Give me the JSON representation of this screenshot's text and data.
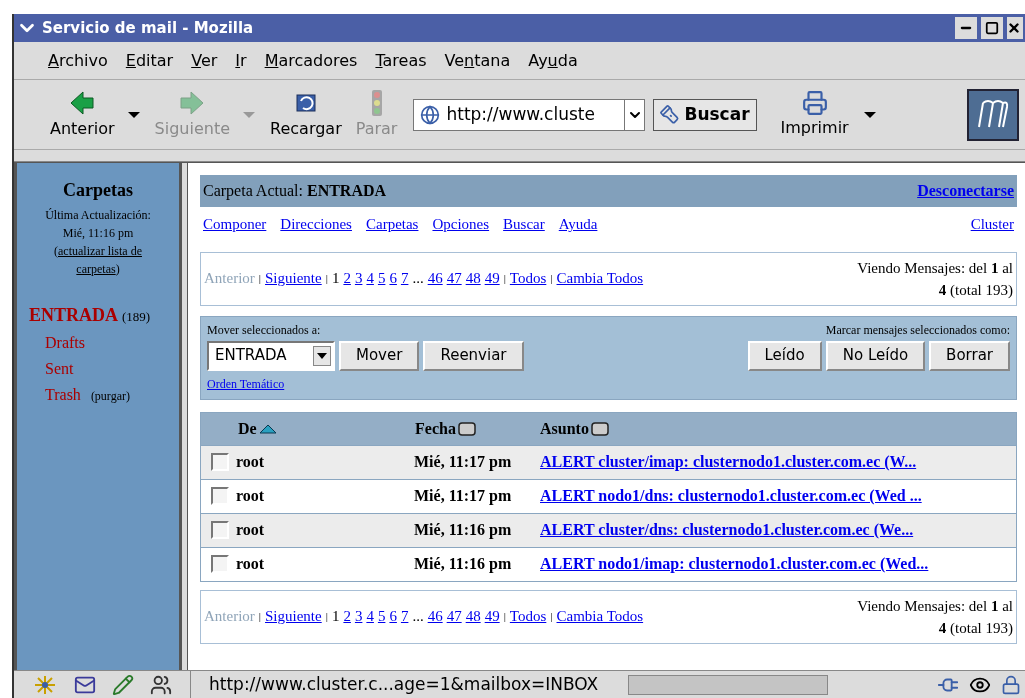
{
  "window": {
    "title": "Servicio de mail - Mozilla"
  },
  "menu": [
    {
      "key": "A",
      "after": "rchivo"
    },
    {
      "key": "E",
      "after": "ditar"
    },
    {
      "key": "V",
      "after": "er"
    },
    {
      "key": "I",
      "after": "r"
    },
    {
      "key": "M",
      "after": "arcadores"
    },
    {
      "key": "T",
      "after": "areas"
    },
    {
      "before": "Ve",
      "key": "n",
      "after": "tana"
    },
    {
      "before": "Ay",
      "key": "u",
      "after": "da"
    }
  ],
  "toolbar": [
    {
      "kind": "back",
      "label": "Anterior",
      "disabled": false,
      "dropdown": true
    },
    {
      "kind": "forward",
      "label": "Siguiente",
      "disabled": true,
      "dropdown": true
    },
    {
      "kind": "reload",
      "label": "Recargar",
      "disabled": false,
      "dropdown": false
    },
    {
      "kind": "stop",
      "label": "Parar",
      "disabled": true,
      "dropdown": false
    }
  ],
  "address": {
    "value": "http://www.cluste"
  },
  "search_button": "Buscar",
  "print": {
    "label": "Imprimir",
    "dropdown": true
  },
  "sidebar": {
    "title": "Carpetas",
    "updated_label": "Última Actualización:",
    "updated_time": "Mié, 11:16 pm",
    "refresh_open": "(",
    "refresh_link": "actualizar lista de carpetas",
    "refresh_close": ")",
    "folders": [
      {
        "name": "ENTRADA",
        "count": "(189)",
        "selected": true
      },
      {
        "name": "Drafts",
        "selected": false
      },
      {
        "name": "Sent",
        "selected": false
      },
      {
        "name": "Trash",
        "extra": "(purgar)",
        "selected": false
      }
    ]
  },
  "header": {
    "text": "Carpeta Actual: **ENTRADA**",
    "logout": "Desconectarse"
  },
  "nav_links": [
    "Componer",
    "Direcciones",
    "Carpetas",
    "Opciones",
    "Buscar",
    "Ayuda"
  ],
  "nav_right": "Cluster",
  "pagination_top": {
    "items": [
      {
        "kind": "disabled",
        "text": "Anterior"
      },
      {
        "kind": "separator",
        "text": "|"
      },
      {
        "kind": "link",
        "text": "Siguiente"
      },
      {
        "kind": "separator",
        "text": "|"
      },
      {
        "kind": "current",
        "text": "1"
      },
      {
        "kind": "link",
        "text": "2"
      },
      {
        "kind": "link",
        "text": "3"
      },
      {
        "kind": "link",
        "text": "4"
      },
      {
        "kind": "link",
        "text": "5"
      },
      {
        "kind": "link",
        "text": "6"
      },
      {
        "kind": "link",
        "text": "7"
      },
      {
        "kind": "text",
        "text": "..."
      },
      {
        "kind": "link",
        "text": "46"
      },
      {
        "kind": "link",
        "text": "47"
      },
      {
        "kind": "link",
        "text": "48"
      },
      {
        "kind": "link",
        "text": "49"
      },
      {
        "kind": "separator",
        "text": "|"
      },
      {
        "kind": "link",
        "text": "Todos"
      },
      {
        "kind": "separator",
        "text": "|"
      },
      {
        "kind": "link",
        "text": "Cambia Todos"
      }
    ],
    "viewing_line1": "Viendo Mensajes: del **1** al",
    "viewing_line2": "**4** (total 193)"
  },
  "actions": {
    "move_label": "Mover seleccionados a:",
    "mark_label": "Marcar mensajes seleccionados como:",
    "folder_select": "ENTRADA",
    "move_buttons": [
      "Mover",
      "Reenviar"
    ],
    "mark_buttons": [
      "Leído",
      "No Leído",
      "Borrar"
    ],
    "thread_link": "Orden Temático"
  },
  "table": {
    "columns": [
      {
        "label": "De",
        "sorted": true
      },
      {
        "label": "Fecha",
        "sorted": false
      },
      {
        "label": "Asunto",
        "sorted": false
      }
    ],
    "rows": [
      {
        "checked": false,
        "from": "root",
        "date": "Mié, 11:17 pm",
        "subject": "ALERT cluster/imap: clusternodo1.cluster.com.ec (W..."
      },
      {
        "checked": false,
        "from": "root",
        "date": "Mié, 11:17 pm",
        "subject": "ALERT nodo1/dns: clusternodo1.cluster.com.ec (Wed ..."
      },
      {
        "checked": false,
        "from": "root",
        "date": "Mié, 11:16 pm",
        "subject": "ALERT cluster/dns: clusternodo1.cluster.com.ec (We..."
      },
      {
        "checked": false,
        "from": "root",
        "date": "Mié, 11:16 pm",
        "subject": "ALERT nodo1/imap: clusternodo1.cluster.com.ec (Wed..."
      }
    ]
  },
  "pagination_bottom": {
    "items": [
      {
        "kind": "disabled",
        "text": "Anterior"
      },
      {
        "kind": "separator",
        "text": "|"
      },
      {
        "kind": "link",
        "text": "Siguiente"
      },
      {
        "kind": "separator",
        "text": "|"
      },
      {
        "kind": "current",
        "text": "1"
      },
      {
        "kind": "link",
        "text": "2"
      },
      {
        "kind": "link",
        "text": "3"
      },
      {
        "kind": "link",
        "text": "4"
      },
      {
        "kind": "link",
        "text": "5"
      },
      {
        "kind": "link",
        "text": "6"
      },
      {
        "kind": "link",
        "text": "7"
      },
      {
        "kind": "text",
        "text": "..."
      },
      {
        "kind": "link",
        "text": "46"
      },
      {
        "kind": "link",
        "text": "47"
      },
      {
        "kind": "link",
        "text": "48"
      },
      {
        "kind": "link",
        "text": "49"
      },
      {
        "kind": "separator",
        "text": "|"
      },
      {
        "kind": "link",
        "text": "Todos"
      },
      {
        "kind": "separator",
        "text": "|"
      },
      {
        "kind": "link",
        "text": "Cambia Todos"
      }
    ],
    "viewing_line1": "Viendo Mensajes: del **1** al",
    "viewing_line2": "**4** (total 193)"
  },
  "status_bar": {
    "url": "http://www.cluster.c...age=1&mailbox=INBOX"
  }
}
